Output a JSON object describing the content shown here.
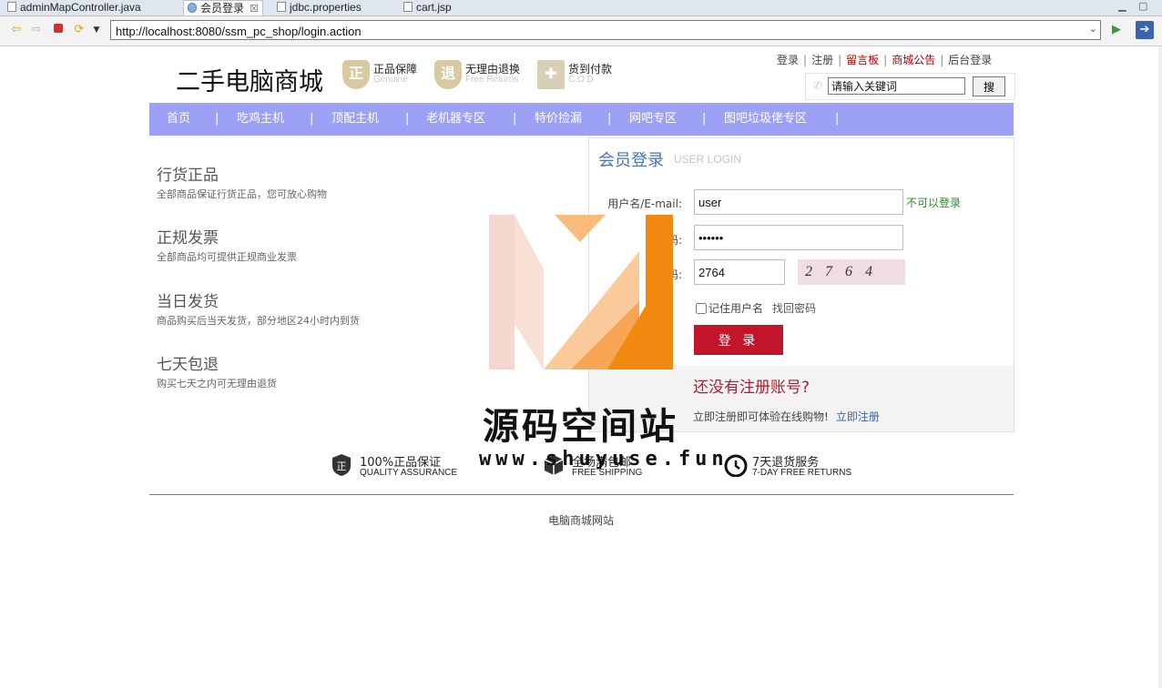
{
  "ide_tabs": [
    {
      "label": "adminMapController.java",
      "active": false
    },
    {
      "label": "会员登录",
      "active": true
    },
    {
      "label": "jdbc.properties",
      "active": false
    },
    {
      "label": "cart.jsp",
      "active": false
    }
  ],
  "browser": {
    "url": "http://localhost:8080/ssm_pc_shop/login.action"
  },
  "header": {
    "logo": "二手电脑商城",
    "badges": [
      {
        "title": "正品保障",
        "subtitle": "Genuine",
        "icon": "shield-zheng-icon",
        "glyph": "正"
      },
      {
        "title": "无理由退换",
        "subtitle": "Free Returns",
        "icon": "shield-return-icon",
        "glyph": "退"
      },
      {
        "title": "货到付款",
        "subtitle": "C.O.D",
        "icon": "cod-icon",
        "glyph": "✚"
      }
    ],
    "top_links": {
      "login": "登录",
      "register": "注册",
      "message_board": "留言板",
      "announcement": "商城公告",
      "admin_login": "后台登录"
    },
    "search": {
      "value": "请输入关键词",
      "button": "搜"
    }
  },
  "nav": {
    "items": [
      "首页",
      "吃鸡主机",
      "顶配主机",
      "老机器专区",
      "特价捡漏",
      "网吧专区",
      "图吧垃圾佬专区"
    ]
  },
  "features": [
    {
      "title": "行货正品",
      "desc": "全部商品保证行货正品，您可放心购物"
    },
    {
      "title": "正规发票",
      "desc": "全部商品均可提供正规商业发票"
    },
    {
      "title": "当日发货",
      "desc": "商品购买后当天发货，部分地区24小时内到货"
    },
    {
      "title": "七天包退",
      "desc": "购买七天之内可无理由退货"
    }
  ],
  "login": {
    "title": "会员登录",
    "subtitle": "USER LOGIN",
    "username_label": "用户名/E-mail:",
    "username_value": "user",
    "username_status": "不可以登录",
    "password_label": "码:",
    "password_value": "••••••",
    "captcha_label": "码:",
    "captcha_value": "2764",
    "captcha_image_text": "2764",
    "remember_label": "记住用户名",
    "forgot_label": "找回密码",
    "submit_label": "登 录",
    "register_question": "还没有注册账号?",
    "register_text": "立即注册即可体验在线购物!",
    "register_link": "立即注册"
  },
  "watermark": {
    "title": "源码空间站",
    "url": "www.shuyuse.fun"
  },
  "guarantees": [
    {
      "title": "100%正品保证",
      "subtitle": "QUALITY ASSURANCE",
      "icon": "shield-icon"
    },
    {
      "title": "全场满包邮",
      "subtitle": "FREE SHIPPING",
      "icon": "box-icon"
    },
    {
      "title": "7天退货服务",
      "subtitle": "7-DAY FREE RETURNS",
      "icon": "clock-icon"
    }
  ],
  "footer": {
    "text": "电脑商城网站"
  },
  "colors": {
    "nav_bg": "#9da1f6",
    "login_button": "#c2152b",
    "accent_blue": "#4a73b8",
    "register_red": "#b21e2e",
    "status_green": "#2d8a2d"
  }
}
